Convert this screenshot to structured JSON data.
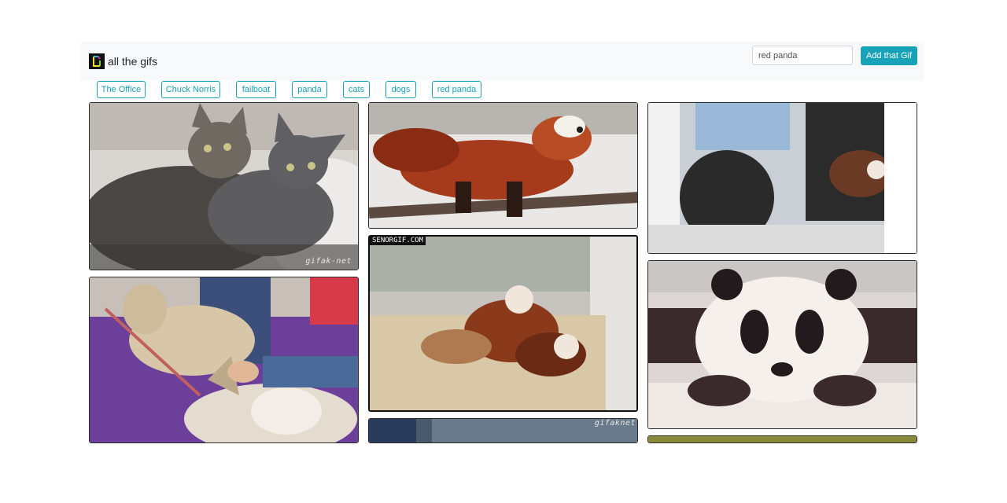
{
  "brand": {
    "title": "all the gifs",
    "logo_icon": "gif-logo-icon"
  },
  "search": {
    "value": "red panda",
    "button_label": "Add that Gif"
  },
  "colors": {
    "accent": "#17a2b8",
    "navbar_bg": "#f8f9fa"
  },
  "tags": [
    {
      "label": "The Office"
    },
    {
      "label": "Chuck Norris"
    },
    {
      "label": "failboat"
    },
    {
      "label": "panda"
    },
    {
      "label": "cats"
    },
    {
      "label": "dogs"
    },
    {
      "label": "red panda"
    }
  ],
  "gifs": [
    {
      "subject": "two cats cuddling",
      "watermark": "gifak-net"
    },
    {
      "subject": "red panda walking on branch"
    },
    {
      "subject": "red panda climbing out of window"
    },
    {
      "subject": "husky dogs being petted"
    },
    {
      "subject": "red pandas playing",
      "watermark_top": "SENORGIF.COM",
      "watermark": "gifaknet"
    },
    {
      "subject": "panda cub"
    },
    {
      "subject": "gif partially visible"
    },
    {
      "subject": "gif partially visible"
    }
  ]
}
